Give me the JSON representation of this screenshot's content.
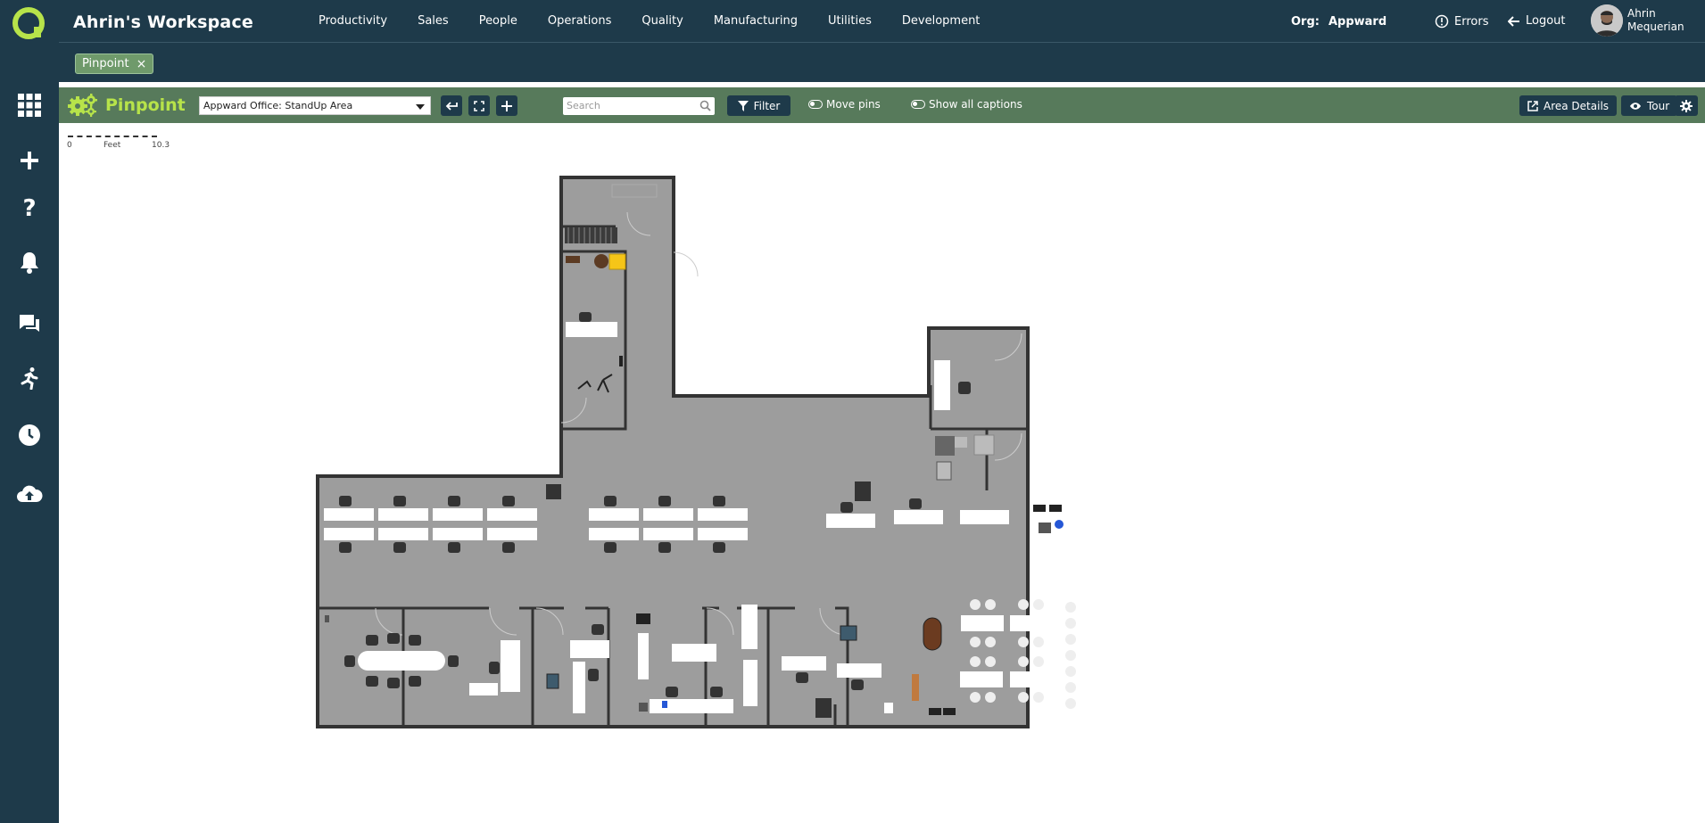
{
  "workspace_title": "Ahrin's Workspace",
  "nav": [
    "Productivity",
    "Sales",
    "People",
    "Operations",
    "Quality",
    "Manufacturing",
    "Utilities",
    "Development"
  ],
  "org": {
    "label": "Org:",
    "value": "Appward"
  },
  "errors_label": "Errors",
  "logout_label": "Logout",
  "user": {
    "first": "Ahrin",
    "last": "Mequerian"
  },
  "chip": {
    "label": "Pinpoint",
    "close": "×"
  },
  "toolbar": {
    "app_name": "Pinpoint",
    "area_select": "Appward Office: StandUp Area",
    "search_placeholder": "Search",
    "filter_label": "Filter",
    "move_pins_label": "Move pins",
    "show_captions_label": "Show all captions",
    "area_details_label": "Area Details",
    "tour_label": "Tour"
  },
  "scale": {
    "start": "0",
    "unit": "Feet",
    "end": "10.3"
  },
  "colors": {
    "rail": "#1e3a4a",
    "toolbar": "#577a5b",
    "accent": "#b7e34a",
    "floor": "#9d9d9d",
    "wall": "#333333"
  },
  "rail_icons": [
    "apps-grid-icon",
    "plus-icon",
    "help-icon",
    "bell-icon",
    "chat-icon",
    "runner-icon",
    "clock-icon",
    "cloud-upload-icon"
  ]
}
